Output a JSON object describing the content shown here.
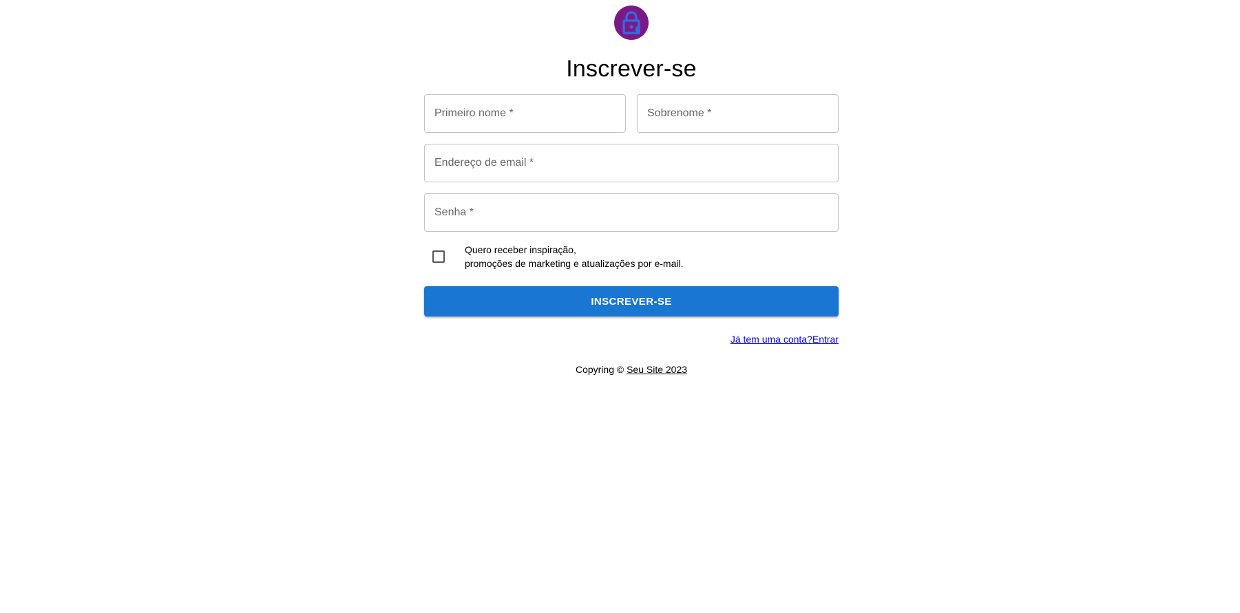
{
  "header": {
    "logo_icon": "lock-icon",
    "title": "Inscrever-se"
  },
  "form": {
    "first_name": {
      "placeholder": "Primeiro nome *",
      "value": ""
    },
    "last_name": {
      "placeholder": "Sobrenome *",
      "value": ""
    },
    "email": {
      "placeholder": "Endereço de email *",
      "value": ""
    },
    "password": {
      "placeholder": "Senha *",
      "value": ""
    },
    "consent": {
      "checked": false,
      "line1": "Quero receber inspiração,",
      "line2": "promoções de marketing e atualizações por e-mail."
    },
    "submit_label": "INSCREVER-SE"
  },
  "signin": {
    "question": "Já tem uma conta?",
    "action": "Entrar"
  },
  "footer": {
    "prefix": "Copyring © ",
    "site_link": "Seu Site 2023"
  },
  "colors": {
    "primary": "#1976d2",
    "avatar_bg": "#7b1a86",
    "lock_icon": "#2f6fe0"
  }
}
